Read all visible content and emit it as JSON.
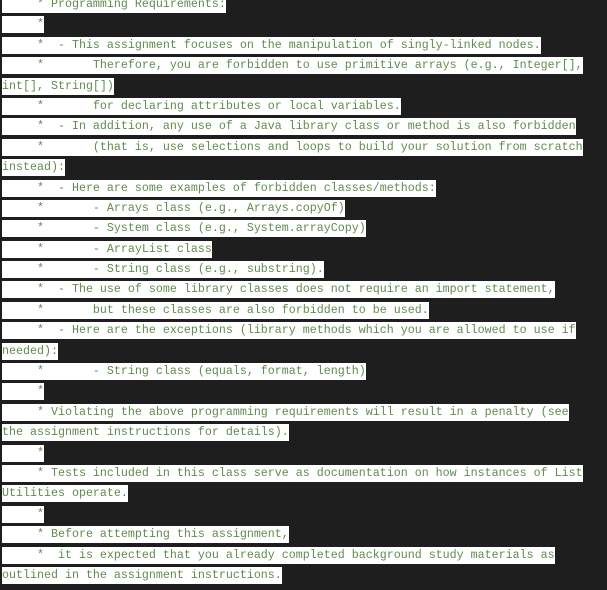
{
  "editor": {
    "colors": {
      "background": "#1e1e1e",
      "selection": "#ffffff",
      "comment_text": "#5f8c4c"
    },
    "lines": [
      "     * Programming Requirements:",
      "     *",
      "     *  - This assignment focuses on the manipulation of singly-linked nodes.",
      "     *       Therefore, you are forbidden to use primitive arrays (e.g., Integer[],",
      "int[], String[])",
      "     *       for declaring attributes or local variables.",
      "     *  - In addition, any use of a Java library class or method is also forbidden",
      "     *       (that is, use selections and loops to build your solution from scratch",
      "instead):",
      "     *  - Here are some examples of forbidden classes/methods:",
      "     *       - Arrays class (e.g., Arrays.copyOf)",
      "     *       - System class (e.g., System.arrayCopy)",
      "     *       - ArrayList class",
      "     *       - String class (e.g., substring).",
      "     *  - The use of some library classes does not require an import statement,",
      "     *       but these classes are also forbidden to be used.",
      "     *  - Here are the exceptions (library methods which you are allowed to use if",
      "needed):",
      "     *       - String class (equals, format, length)",
      "     *",
      "     * Violating the above programming requirements will result in a penalty (see",
      "the assignment instructions for details).",
      "     *",
      "     * Tests included in this class serve as documentation on how instances of List",
      "Utilities operate.",
      "     *",
      "     * Before attempting this assignment,",
      "     *  it is expected that you already completed background study materials as",
      "outlined in the assignment instructions."
    ]
  }
}
